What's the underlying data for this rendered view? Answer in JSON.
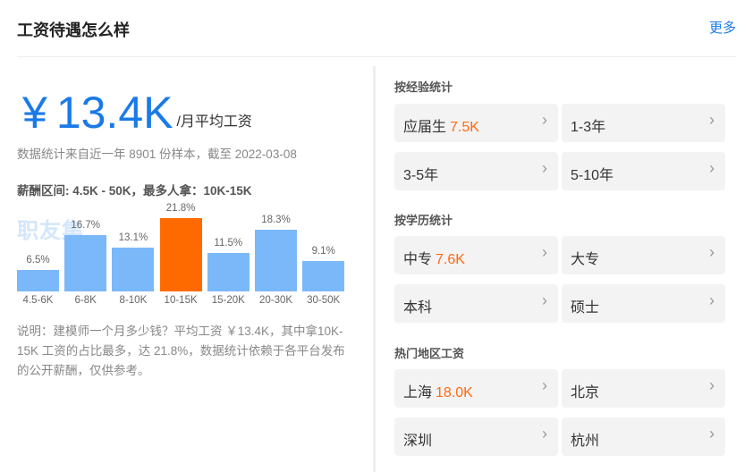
{
  "header": {
    "title": "工资待遇怎么样",
    "more": "更多"
  },
  "summary": {
    "currency_symbol": "¥",
    "average": "13.4K",
    "unit": "/月平均工资",
    "source": "数据统计来自近一年 8901 份样本，截至 2022-03-08",
    "range": "薪酬区间: 4.5K - 50K，最多人拿：10K-15K",
    "watermark": "职友集"
  },
  "chart_data": {
    "type": "bar",
    "categories": [
      "4.5-6K",
      "6-8K",
      "8-10K",
      "10-15K",
      "15-20K",
      "20-30K",
      "30-50K"
    ],
    "values": [
      6.5,
      16.7,
      13.1,
      21.8,
      11.5,
      18.3,
      9.1
    ],
    "value_labels": [
      "6.5%",
      "16.7%",
      "13.1%",
      "21.8%",
      "11.5%",
      "18.3%",
      "9.1%"
    ],
    "highlight_index": 3,
    "colors": {
      "normal": "#7bb8f9",
      "highlight": "#ff6a00"
    }
  },
  "description": "说明：建模师一个月多少钱？平均工资 ￥13.4K，其中拿10K-15K 工资的占比最多，达 21.8%，数据统计依赖于各平台发布的公开薪酬，仅供参考。",
  "experience": {
    "title": "按经验统计",
    "items": [
      {
        "label": "应届生",
        "value": "7.5K"
      },
      {
        "label": "1-3年",
        "value": ""
      },
      {
        "label": "3-5年",
        "value": ""
      },
      {
        "label": "5-10年",
        "value": ""
      }
    ]
  },
  "education": {
    "title": "按学历统计",
    "items": [
      {
        "label": "中专",
        "value": "7.6K"
      },
      {
        "label": "大专",
        "value": ""
      },
      {
        "label": "本科",
        "value": ""
      },
      {
        "label": "硕士",
        "value": ""
      }
    ]
  },
  "regions": {
    "title": "热门地区工资",
    "items": [
      {
        "label": "上海",
        "value": "18.0K"
      },
      {
        "label": "北京",
        "value": ""
      },
      {
        "label": "深圳",
        "value": ""
      },
      {
        "label": "杭州",
        "value": ""
      }
    ]
  },
  "icons": {
    "chevron": "chevron-right-icon"
  }
}
